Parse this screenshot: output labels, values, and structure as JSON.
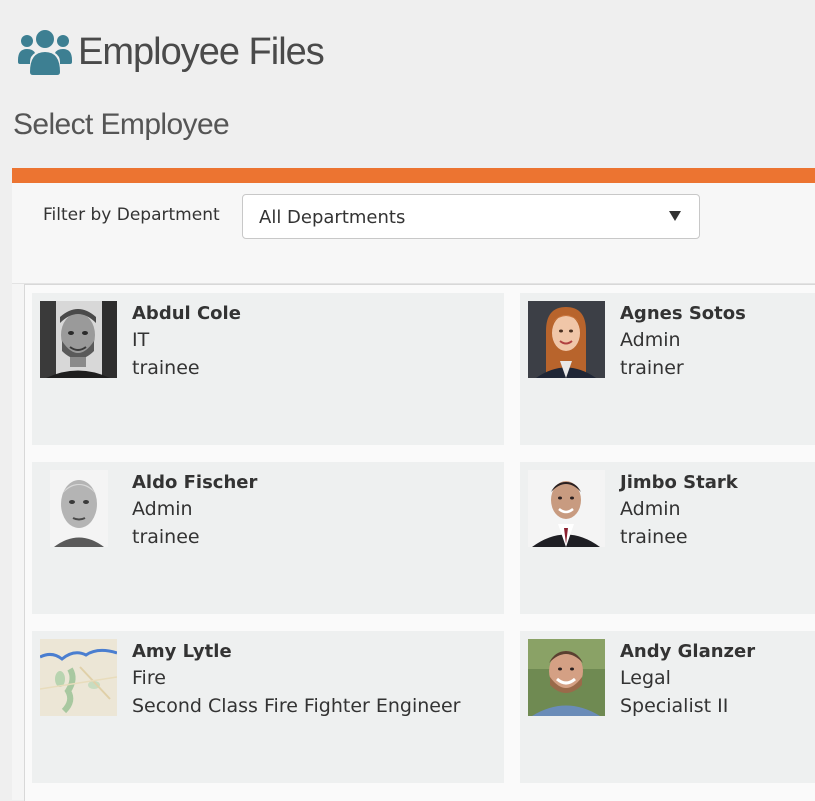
{
  "header": {
    "title": "Employee Files",
    "icon": "users-group-icon",
    "icon_color": "#3d7f92"
  },
  "subtitle": "Select Employee",
  "colors": {
    "accent": "#ec7431",
    "card_bg": "#eef0f0"
  },
  "filter": {
    "label": "Filter by Department",
    "selected": "All Departments"
  },
  "employees": [
    {
      "name": "Abdul Cole",
      "department": "IT",
      "role": "trainee",
      "photo": "man-grayscale-portrait"
    },
    {
      "name": "Agnes Sotos",
      "department": "Admin",
      "role": "trainer",
      "photo": "woman-red-hair-portrait"
    },
    {
      "name": "Aldo Fischer",
      "department": "Admin",
      "role": "trainee",
      "photo": "older-man-grayscale-portrait"
    },
    {
      "name": "Jimbo Stark",
      "department": "Admin",
      "role": "trainee",
      "photo": "man-suit-portrait"
    },
    {
      "name": "Amy Lytle",
      "department": "Fire",
      "role": "Second Class Fire Fighter Engineer",
      "photo": "map-thumbnail"
    },
    {
      "name": "Andy Glanzer",
      "department": "Legal",
      "role": "Specialist II",
      "photo": "man-outdoor-portrait"
    }
  ]
}
